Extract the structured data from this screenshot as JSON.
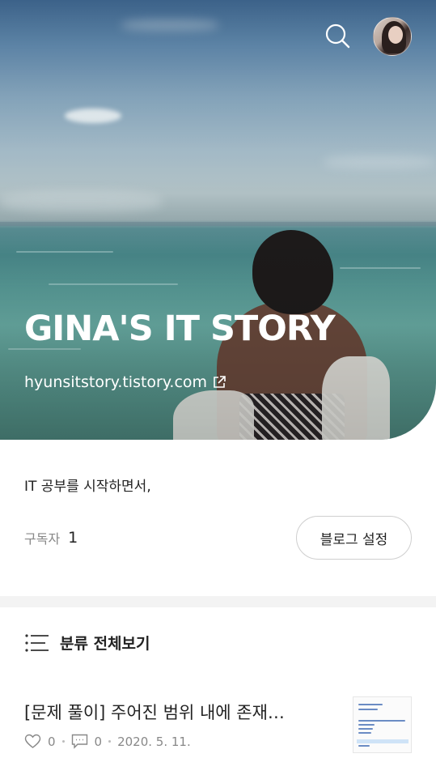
{
  "blog": {
    "title": "GINA'S IT STORY",
    "url": "hyunsitstory.tistory.com",
    "description": "IT 공부를 시작하면서,",
    "subscribers_label": "구독자",
    "subscribers_count": "1",
    "settings_label": "블로그 설정"
  },
  "icons": {
    "search": "search-icon",
    "external_link": "external-link-icon",
    "category_list": "list-icon",
    "like": "heart-icon",
    "comment": "comment-icon"
  },
  "category": {
    "label": "분류 전체보기"
  },
  "posts": [
    {
      "title": "[문제 풀이] 주어진 범위 내에 존재…",
      "likes": "0",
      "comments": "0",
      "date": "2020. 5. 11."
    }
  ]
}
